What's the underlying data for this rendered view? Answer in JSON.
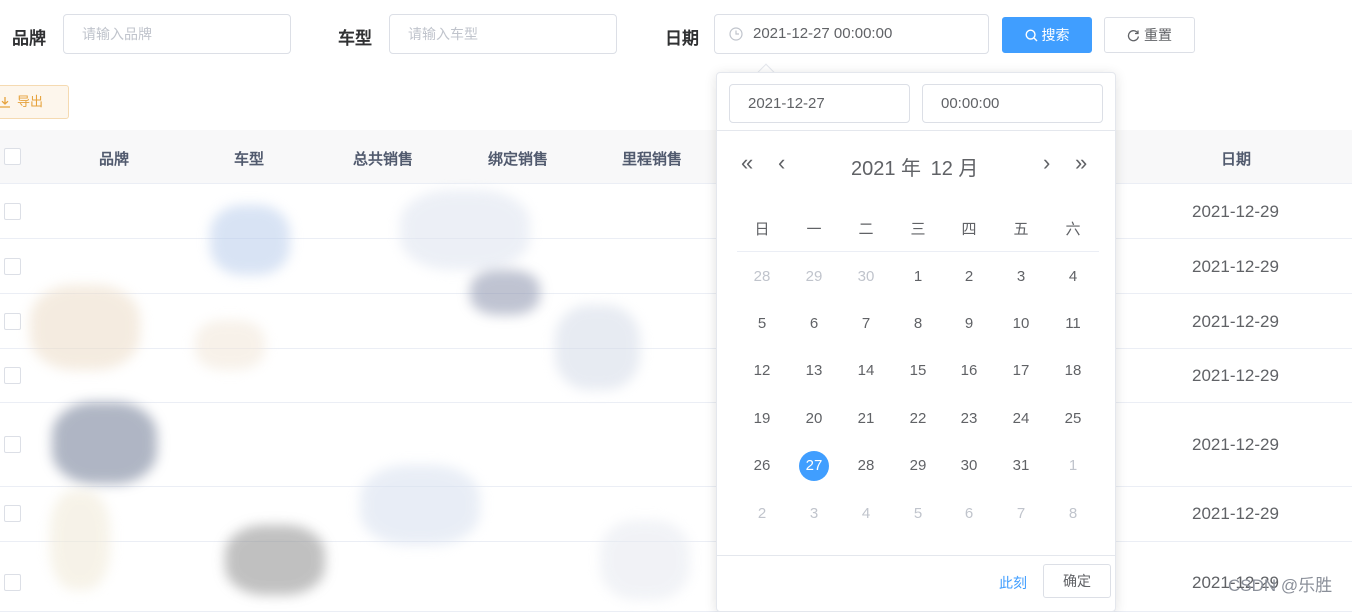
{
  "filters": {
    "brand_label": "品牌",
    "brand_placeholder": "请输入品牌",
    "model_label": "车型",
    "model_placeholder": "请输入车型",
    "date_label": "日期",
    "date_value": "2021-12-27 00:00:00",
    "search_label": "搜索",
    "reset_label": "重置",
    "export_label": "导出"
  },
  "table": {
    "headers": [
      "品牌",
      "车型",
      "总共销售",
      "绑定销售",
      "里程销售",
      "日期"
    ],
    "rows": [
      {
        "date": "2021-12-29"
      },
      {
        "date": "2021-12-29"
      },
      {
        "date": "2021-12-29"
      },
      {
        "date": "2021-12-29"
      },
      {
        "date": "2021-12-29"
      },
      {
        "date": "2021-12-29"
      },
      {
        "date": "2021-12-29"
      }
    ]
  },
  "picker": {
    "date_input": "2021-12-27",
    "time_input": "00:00:00",
    "year_label": "2021 年",
    "month_label": "12 月",
    "weekdays": [
      "日",
      "一",
      "二",
      "三",
      "四",
      "五",
      "六"
    ],
    "weeks": [
      [
        "28",
        "29",
        "30",
        "1",
        "2",
        "3",
        "4"
      ],
      [
        "5",
        "6",
        "7",
        "8",
        "9",
        "10",
        "11"
      ],
      [
        "12",
        "13",
        "14",
        "15",
        "16",
        "17",
        "18"
      ],
      [
        "19",
        "20",
        "21",
        "22",
        "23",
        "24",
        "25"
      ],
      [
        "26",
        "27",
        "28",
        "29",
        "30",
        "31",
        "1"
      ],
      [
        "2",
        "3",
        "4",
        "5",
        "6",
        "7",
        "8"
      ]
    ],
    "selected": "27",
    "now_label": "此刻",
    "confirm_label": "确定"
  },
  "watermark": "CSDN @乐胜",
  "colors": {
    "primary": "#409eff",
    "warning": "#e6a23c",
    "border": "#dcdfe6",
    "text": "#606266"
  },
  "icons": {
    "date_input": "clock-icon",
    "search": "search-icon",
    "reset": "refresh-icon",
    "export": "download-icon",
    "prev_year": "double-chevron-left-icon",
    "prev_month": "chevron-left-icon",
    "next_month": "chevron-right-icon",
    "next_year": "double-chevron-right-icon"
  }
}
